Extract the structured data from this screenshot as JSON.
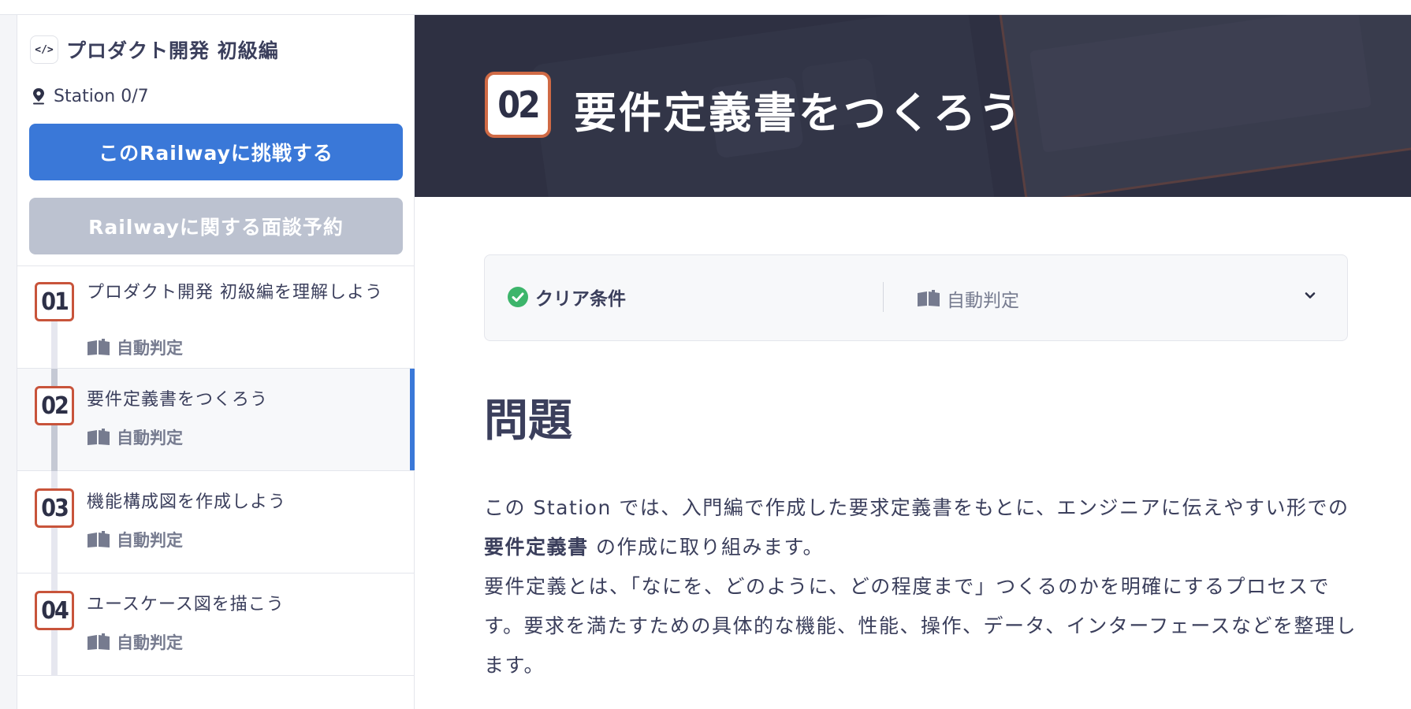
{
  "sidebar": {
    "course_icon": "code-icon",
    "course_icon_text": "</>",
    "course_title": "プロダクト開発 初級編",
    "station_progress": "Station 0/7",
    "primary_button": "このRailwayに挑戦する",
    "secondary_button": "Railwayに関する面談予約",
    "stations": [
      {
        "number": "01",
        "title": "プロダクト開発 初級編を理解しよう",
        "meta": "自動判定",
        "active": false
      },
      {
        "number": "02",
        "title": "要件定義書をつくろう",
        "meta": "自動判定",
        "active": true
      },
      {
        "number": "03",
        "title": "機能構成図を作成しよう",
        "meta": "自動判定",
        "active": false
      },
      {
        "number": "04",
        "title": "ユースケース図を描こう",
        "meta": "自動判定",
        "active": false
      }
    ]
  },
  "hero": {
    "number": "02",
    "title": "要件定義書をつくろう"
  },
  "clear_condition": {
    "label": "クリア条件",
    "judge": "自動判定",
    "icons": {
      "status": "check-circle-icon",
      "judge": "book-icon",
      "toggle": "chevron-down-icon"
    }
  },
  "content": {
    "section_title": "問題",
    "para1_a": "この Station では、入門編で作成した要求定義書をもとに、エンジニアに伝えやすい形での ",
    "para1_bold": "要件定義書",
    "para1_b": " の作成に取り組みます。",
    "para2": "要件定義とは、「なにを、どのように、どの程度まで」つくるのかを明確にするプロセスです。要求を満たすための具体的な機能、性能、操作、データ、インターフェースなどを整理します。"
  },
  "colors": {
    "accent": "#3a78d8",
    "badge_border": "#c8543b",
    "hero_bg": "#2f3142",
    "check_green": "#3db56b",
    "secondary_button": "#bcc2d0"
  }
}
